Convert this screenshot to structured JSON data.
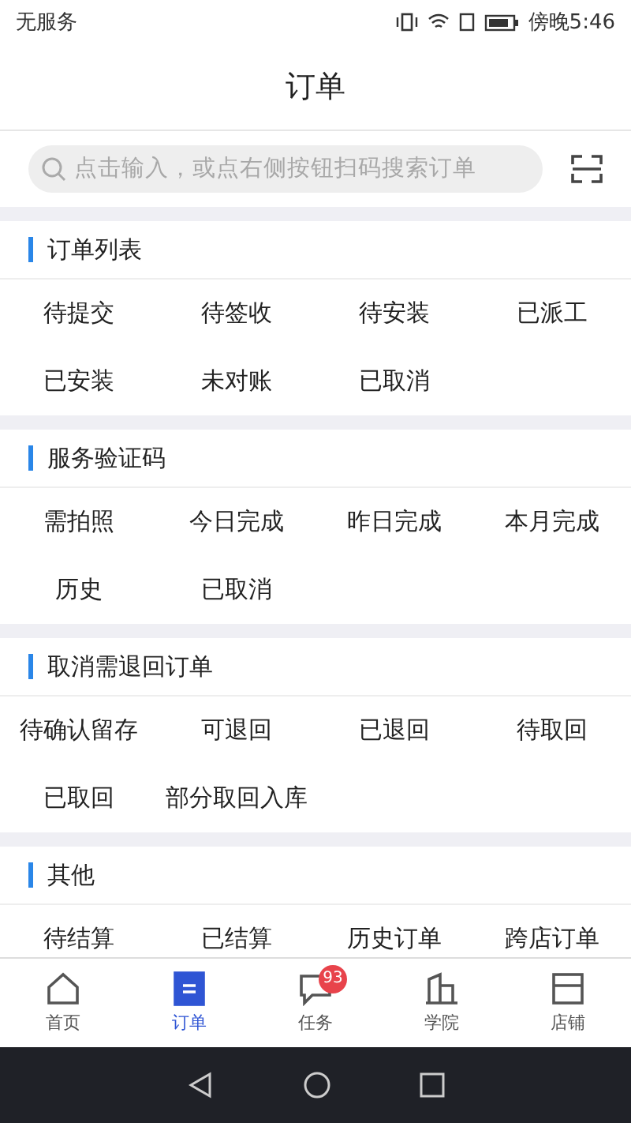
{
  "status_bar": {
    "carrier": "无服务",
    "time": "傍晚5:46"
  },
  "header": {
    "title": "订单"
  },
  "search": {
    "placeholder": "点击输入，或点右侧按钮扫码搜索订单"
  },
  "sections": [
    {
      "title": "订单列表",
      "items": [
        "待提交",
        "待签收",
        "待安装",
        "已派工",
        "已安装",
        "未对账",
        "已取消"
      ]
    },
    {
      "title": "服务验证码",
      "items": [
        "需拍照",
        "今日完成",
        "昨日完成",
        "本月完成",
        "历史",
        "已取消"
      ]
    },
    {
      "title": "取消需退回订单",
      "items": [
        "待确认留存",
        "可退回",
        "已退回",
        "待取回",
        "已取回",
        "部分取回入库"
      ]
    },
    {
      "title": "其他",
      "items": [
        "待结算",
        "已结算",
        "历史订单",
        "跨店订单"
      ]
    }
  ],
  "tabs": [
    {
      "label": "首页",
      "kind": "home",
      "selected": false
    },
    {
      "label": "订单",
      "kind": "orders",
      "selected": true
    },
    {
      "label": "任务",
      "kind": "tasks",
      "selected": false,
      "badge": "93"
    },
    {
      "label": "学院",
      "kind": "academy",
      "selected": false
    },
    {
      "label": "店铺",
      "kind": "store",
      "selected": false
    }
  ]
}
